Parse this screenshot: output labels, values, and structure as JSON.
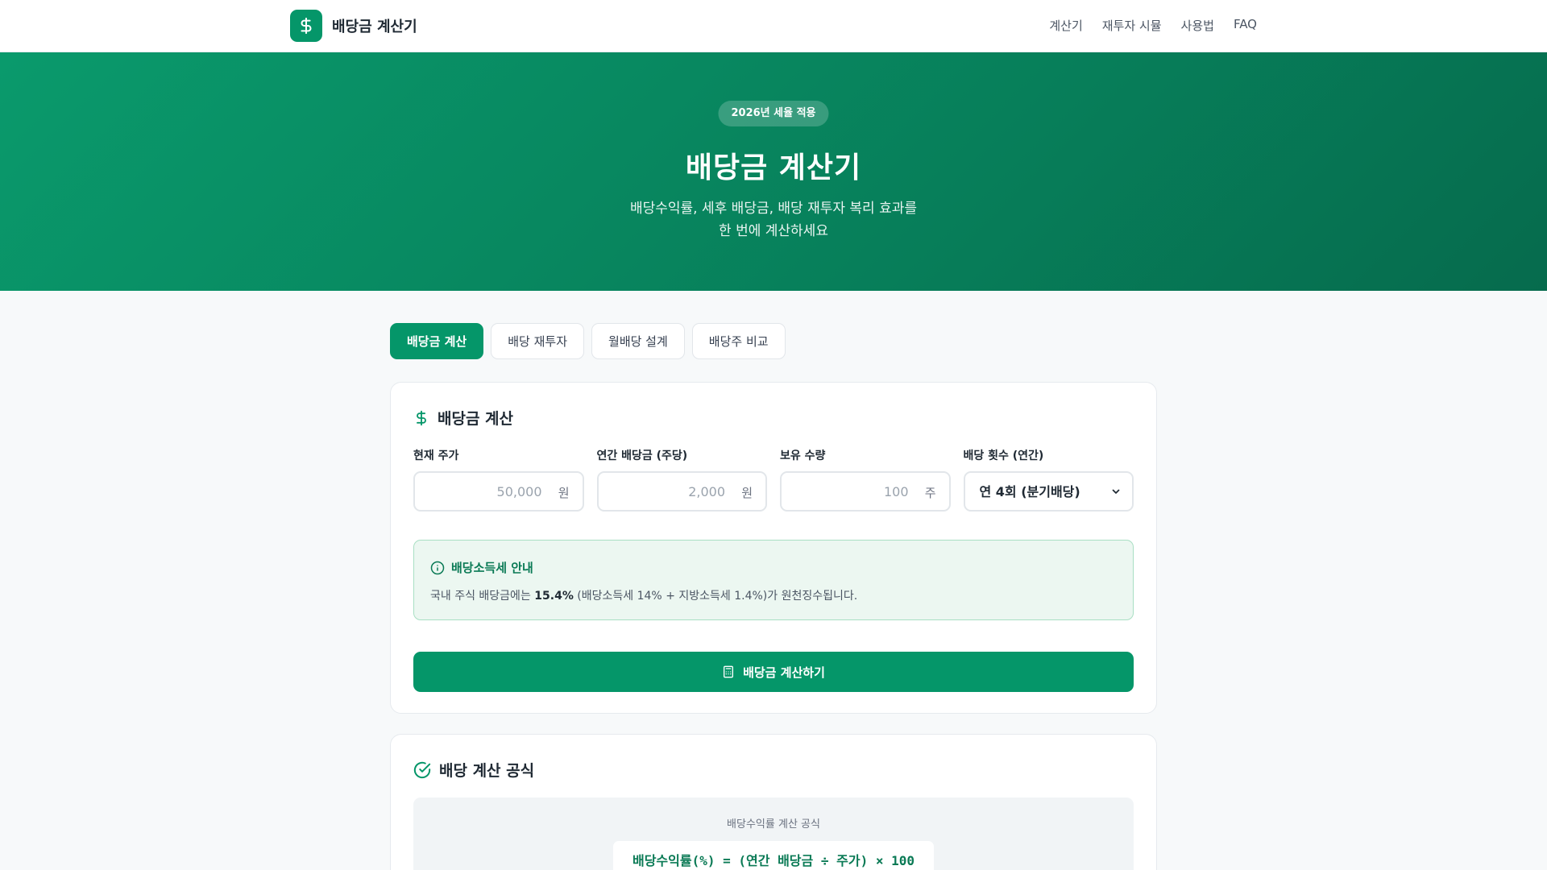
{
  "header": {
    "brand_name": "배당금 계산기",
    "nav": [
      "계산기",
      "재투자 시뮬",
      "사용법",
      "FAQ"
    ]
  },
  "hero": {
    "badge": "2026년 세율 적용",
    "title": "배당금 계산기",
    "subtitle_line1": "배당수익률, 세후 배당금, 배당 재투자 복리 효과를",
    "subtitle_line2": "한 번에 계산하세요"
  },
  "tabs": [
    {
      "label": "배당금 계산",
      "active": true
    },
    {
      "label": "배당 재투자",
      "active": false
    },
    {
      "label": "월배당 설계",
      "active": false
    },
    {
      "label": "배당주 비교",
      "active": false
    }
  ],
  "calc_card": {
    "title": "배당금 계산",
    "fields": {
      "price": {
        "label": "현재 주가",
        "placeholder": "50,000",
        "unit": "원"
      },
      "dividend": {
        "label": "연간 배당금 (주당)",
        "placeholder": "2,000",
        "unit": "원"
      },
      "shares": {
        "label": "보유 수량",
        "placeholder": "100",
        "unit": "주"
      },
      "frequency": {
        "label": "배당 횟수 (연간)",
        "selected": "연 4회 (분기배당)"
      }
    },
    "notice": {
      "title": "배당소득세 안내",
      "text_before": "국내 주식 배당금에는 ",
      "text_bold": "15.4%",
      "text_after": " (배당소득세 14% + 지방소득세 1.4%)가 원천징수됩니다."
    },
    "submit_label": "배당금 계산하기"
  },
  "formula_card": {
    "title": "배당 계산 공식",
    "formula_label": "배당수익률 계산 공식",
    "formula": "배당수익률(%) = (연간 배당금 ÷ 주가) × 100"
  },
  "colors": {
    "accent": "#059669",
    "accent_dark": "#0a7a55",
    "notice_bg": "#ecf7f1",
    "notice_border": "#a9dfc4"
  },
  "icons": {
    "brand": "dollar-icon",
    "calc_card": "dollar-icon",
    "notice": "info-circle-icon",
    "submit": "calculator-icon",
    "formula_card": "check-circle-icon",
    "select": "chevron-down-icon"
  }
}
